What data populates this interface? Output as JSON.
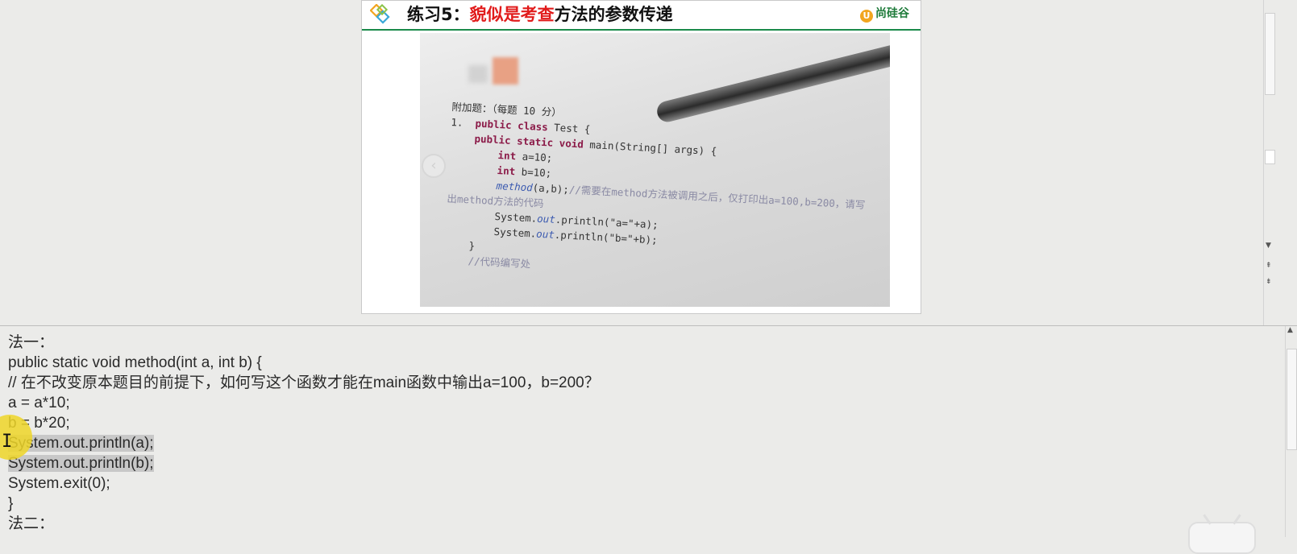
{
  "slide": {
    "title_prefix": "练习5：",
    "title_red": "貌似是考查",
    "title_suffix": "方法的参数传递",
    "logo_mark": "U",
    "logo_text": "尚硅谷",
    "accent_color": "#e11b1b",
    "rule_color": "#1a8a4a",
    "prev_icon": "chevron-left-icon",
    "photo_lines": [
      {
        "parts": [
          {
            "t": "附加题：（每题 10 分）",
            "c": ""
          }
        ]
      },
      {
        "parts": [
          {
            "t": "1.  ",
            "c": ""
          },
          {
            "t": "public class",
            "c": "kw"
          },
          {
            "t": " Test {",
            "c": ""
          }
        ]
      },
      {
        "parts": [
          {
            "t": "    ",
            "c": ""
          },
          {
            "t": "public static void",
            "c": "kw"
          },
          {
            "t": " main(String[] args) {",
            "c": ""
          }
        ]
      },
      {
        "parts": [
          {
            "t": "        ",
            "c": ""
          },
          {
            "t": "int",
            "c": "kw"
          },
          {
            "t": " a=10;",
            "c": ""
          }
        ]
      },
      {
        "parts": [
          {
            "t": "        ",
            "c": ""
          },
          {
            "t": "int",
            "c": "kw"
          },
          {
            "t": " b=10;",
            "c": ""
          }
        ]
      },
      {
        "parts": [
          {
            "t": "        ",
            "c": ""
          },
          {
            "t": "method",
            "c": "it"
          },
          {
            "t": "(a,b);",
            "c": ""
          },
          {
            "t": "//需要在method方法被调用之后，仅打印出a=100,b=200，请写",
            "c": "cm"
          }
        ]
      },
      {
        "parts": [
          {
            "t": "出method方法的代码",
            "c": "cm"
          }
        ]
      },
      {
        "parts": [
          {
            "t": "        System.",
            "c": ""
          },
          {
            "t": "out",
            "c": "it"
          },
          {
            "t": ".println(\"a=\"+a);",
            "c": ""
          }
        ]
      },
      {
        "parts": [
          {
            "t": "        System.",
            "c": ""
          },
          {
            "t": "out",
            "c": "it"
          },
          {
            "t": ".println(\"b=\"+b);",
            "c": ""
          }
        ]
      },
      {
        "parts": [
          {
            "t": "    }",
            "c": ""
          }
        ]
      },
      {
        "parts": [
          {
            "t": "    //代码编写处",
            "c": "cm"
          }
        ]
      }
    ]
  },
  "notes": {
    "lines": [
      {
        "text": "法一：",
        "selected": false
      },
      {
        "text": "public static void method(int a, int b) {",
        "selected": false
      },
      {
        "text": "// 在不改变原本题目的前提下，如何写这个函数才能在main函数中输出a=100，b=200？",
        "selected": false
      },
      {
        "text": "a = a*10;",
        "selected": false
      },
      {
        "text": "b = b*20;",
        "selected": false
      },
      {
        "text": "System.out.println(a);",
        "selected": true
      },
      {
        "text": "System.out.println(b);",
        "selected": true
      },
      {
        "text": "System.exit(0);",
        "selected": false
      },
      {
        "text": "}",
        "selected": false
      },
      {
        "text": "法二：",
        "selected": false
      }
    ]
  },
  "scrollbars": {
    "slide_pane": {
      "up_icon": "arrow-up-icon",
      "down_icon": "arrow-down-icon"
    },
    "notes_pane": {
      "up_icon": "arrow-up-icon"
    }
  },
  "overlay": {
    "cursor": "i-beam-cursor-icon",
    "widget": "tv-icon"
  }
}
